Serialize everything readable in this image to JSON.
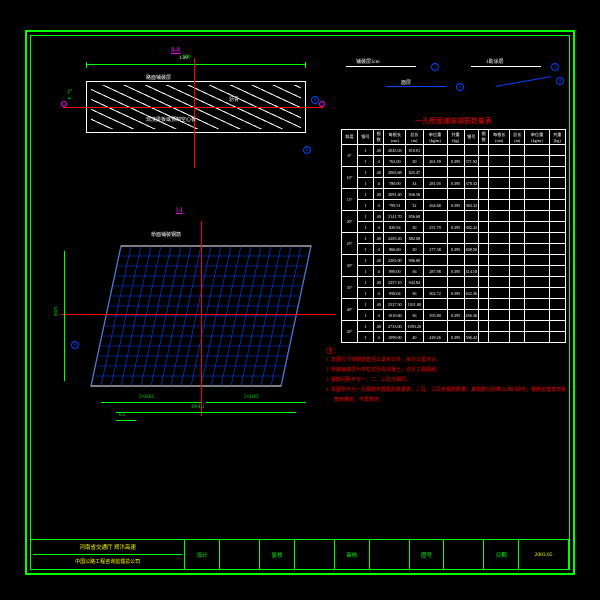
{
  "sectionII": {
    "title": "Ⅱ-Ⅱ",
    "scale": "1:20",
    "dim_top": "620",
    "label_top": "路面铺装层",
    "label_bot": "现浇梁板或预制空心板",
    "label_mid": "沥青",
    "side": "5×4",
    "markA": "A",
    "markB": "B",
    "abut": "Ⅰ"
  },
  "sectionI": {
    "title": "Ⅰ-Ⅰ",
    "label": "桥面铺装钢筋",
    "dim_bot": "39×L1",
    "dim_half1": "5×L0/2",
    "dim_half2": "5×L0/2",
    "dim_edge": "0.5",
    "dim_h": "1200",
    "markA": "A"
  },
  "legend": {
    "l1": "铺装层3cm",
    "c1": "1",
    "l2": "1助涂层",
    "c2": "2",
    "l3": "面层",
    "c3": "3",
    "c4": "4"
  },
  "table": {
    "title": "一孔桥面铺装钢筋数量表",
    "headers": [
      "斜度",
      "钢号",
      "根数",
      "每根长(cm)",
      "总长(m)",
      "单位重(kg/m)",
      "共重(kg)",
      "钢号",
      "根数",
      "每根长(cm)",
      "总长(m)",
      "单位重(kg/m)",
      "共重(kg)"
    ],
    "rows": [
      {
        "angle": "0°",
        "r": [
          [
            "1",
            "40",
            "2045.03",
            "818.01",
            "",
            "",
            ""
          ],
          [
            "1",
            "4",
            "763.00",
            "30",
            "261.59",
            "0.395",
            "371.92"
          ]
        ]
      },
      {
        "angle": "10°",
        "r": [
          [
            "1",
            "40",
            "2063.68",
            "825.47",
            "",
            "",
            ""
          ],
          [
            "1",
            "4",
            "780.00",
            "34",
            "281.05",
            "0.395",
            "378.32"
          ]
        ]
      },
      {
        "angle": "15°",
        "r": [
          [
            "1",
            "40",
            "2091.40",
            "836.56",
            "",
            "",
            ""
          ],
          [
            "1",
            "4",
            "799.51",
            "32",
            "264.68",
            "0.395",
            "384.32"
          ]
        ]
      },
      {
        "angle": "20°",
        "r": [
          [
            "1",
            "40",
            "2141.70",
            "856.68",
            "",
            "",
            ""
          ],
          [
            "1",
            "4",
            "820.94",
            "30",
            "251.79",
            "0.395",
            "392.42"
          ]
        ]
      },
      {
        "angle": "25°",
        "r": [
          [
            "1",
            "40",
            "2205.20",
            "882.08",
            "",
            "",
            ""
          ],
          [
            "1",
            "4",
            "866.60",
            "30",
            "277.38",
            "0.395",
            "408.50"
          ]
        ]
      },
      {
        "angle": "30°",
        "r": [
          [
            "1",
            "40",
            "2265.00",
            "906.00",
            "",
            "",
            ""
          ],
          [
            "1",
            "4",
            "899.00",
            "36",
            "287.98",
            "0.395",
            "414.10"
          ]
        ]
      },
      {
        "angle": "35°",
        "r": [
          [
            "1",
            "40",
            "2357.10",
            "942.84",
            "",
            "",
            ""
          ],
          [
            "1",
            "4",
            "958.04",
            "36",
            "302.72",
            "0.395",
            "432.36"
          ]
        ]
      },
      {
        "angle": "40°",
        "r": [
          [
            "1",
            "40",
            "2527.50",
            "1011.00",
            "",
            "",
            ""
          ],
          [
            "1",
            "4",
            "1010.60",
            "36",
            "395.80",
            "0.395",
            "456.30"
          ]
        ]
      },
      {
        "angle": "45°",
        "r": [
          [
            "1",
            "40",
            "2733.00",
            "1093.20",
            "",
            "",
            ""
          ],
          [
            "1",
            "4",
            "1099.00",
            "40",
            "429.26",
            "0.395",
            "506.42"
          ]
        ]
      }
    ]
  },
  "notes": {
    "title": "注：",
    "items": [
      "1. 本图尺寸除钢筋直径以毫米计外，余均以厘米计。",
      "2. 桥面铺装层为中粒式沥青混凝土，详见工程图纸。",
      "3. 钢筋间距不论一、二、三孔均相同。",
      "4. 本图所示为一孔钢筋布置图及数量表，二孔、三孔桥钢筋数量，其根数分别乘以2和3即可；钢筋长度按顶板宽度确定，不再赘述。"
    ]
  },
  "titleblock": {
    "org1": "河南省交通厅 郑汴高速",
    "org2": "中国公路工程咨询监理总公司",
    "design": "设计",
    "drawn": "复核",
    "check": "审核",
    "dwgno": "图号",
    "date": "日期",
    "dateval": "2003.05"
  }
}
